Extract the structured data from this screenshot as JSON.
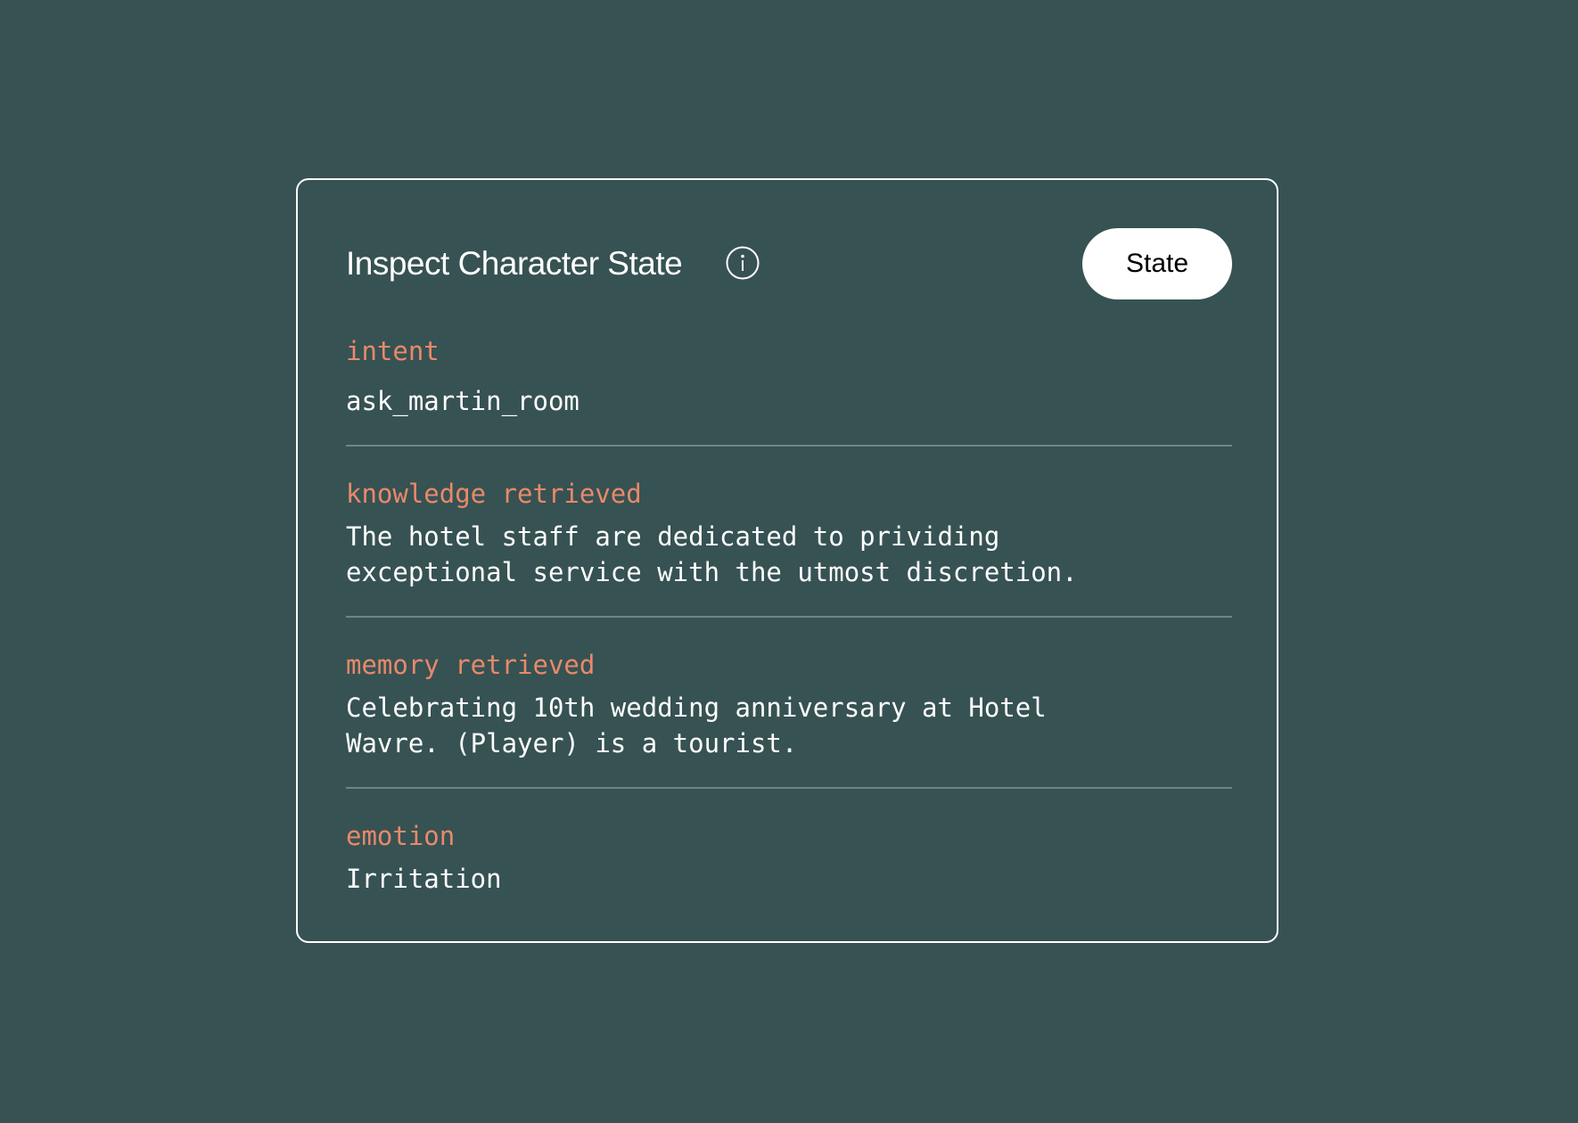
{
  "panel": {
    "title": "Inspect Character State",
    "info_icon": "info-icon",
    "state_button_label": "State"
  },
  "sections": {
    "intent": {
      "label": "intent",
      "value": "ask_martin_room"
    },
    "knowledge": {
      "label": "knowledge retrieved",
      "value": "The hotel staff are dedicated to prividing\nexceptional service with the utmost discretion."
    },
    "memory": {
      "label": "memory retrieved",
      "value": "Celebrating 10th wedding anniversary at Hotel\nWavre. (Player) is a tourist."
    },
    "emotion": {
      "label": "emotion",
      "value": "Irritation"
    }
  },
  "colors": {
    "background": "#375253",
    "label_accent": "#e8896a",
    "text": "#ffffff",
    "divider": "#6e8585"
  }
}
